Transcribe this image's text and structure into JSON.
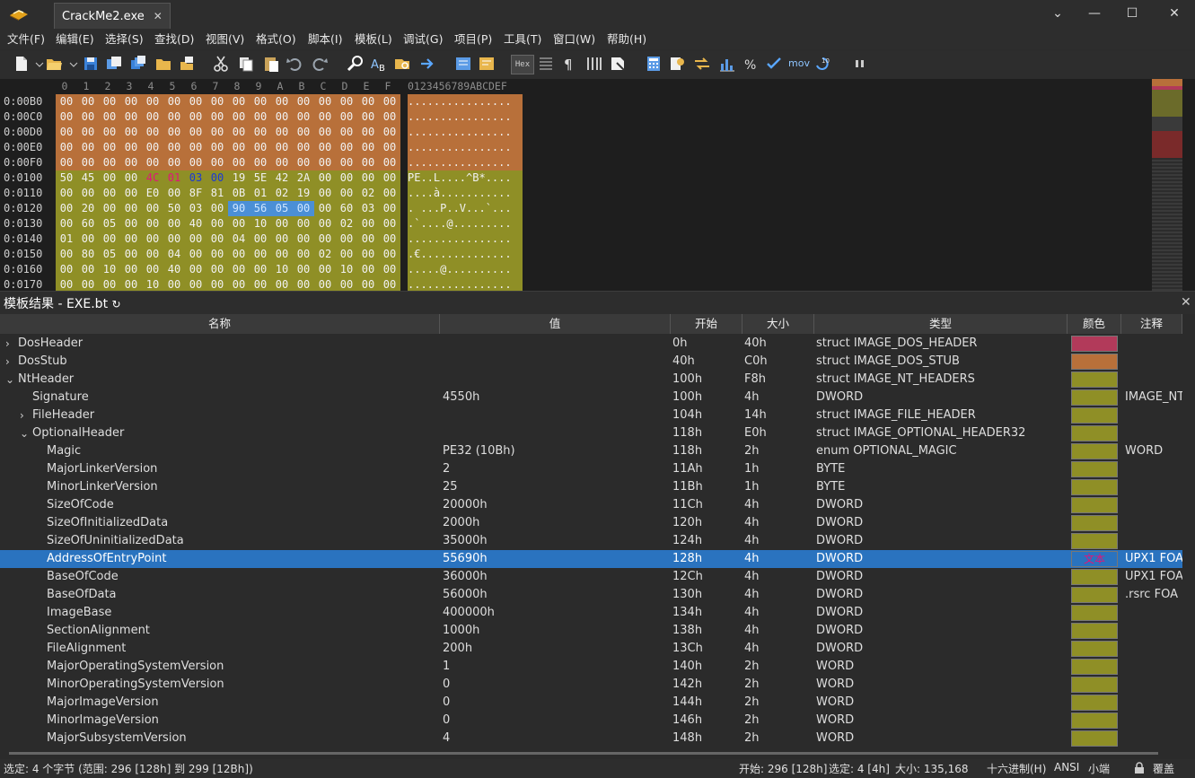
{
  "window": {
    "tab_title": "CrackMe2.exe",
    "tab_close": "✕",
    "controls": [
      "⌄",
      "—",
      "☐",
      "✕"
    ]
  },
  "menu": [
    "文件(F)",
    "编辑(E)",
    "选择(S)",
    "查找(D)",
    "视图(V)",
    "格式(O)",
    "脚本(I)",
    "模板(L)",
    "调试(G)",
    "项目(P)",
    "工具(T)",
    "窗口(W)",
    "帮助(H)"
  ],
  "toolbar": {
    "hex_label": "Hex",
    "mov_label": "mov",
    "icons": [
      "new-file-icon",
      "dropdown-icon",
      "open-folder-icon",
      "dropdown-icon",
      "save-icon",
      "save-as-icon",
      "save-all-icon",
      "open-workspace-icon",
      "folder-tree-icon",
      "cut-icon",
      "copy-icon",
      "paste-icon",
      "undo-icon",
      "redo-icon",
      "find-icon",
      "replace-icon",
      "find-in-files-icon",
      "goto-icon",
      "compare-icon",
      "template-icon",
      "hex-view-icon",
      "column-mode-icon",
      "pilcrow-icon",
      "columns-icon",
      "highlight-icon",
      "calculator-icon",
      "checksum-icon",
      "swap-icon",
      "histogram-icon",
      "percent-icon",
      "check-icon",
      "mov-icon",
      "binary-icon",
      "pause-icon"
    ]
  },
  "hex": {
    "columns": [
      "0",
      "1",
      "2",
      "3",
      "4",
      "5",
      "6",
      "7",
      "8",
      "9",
      "A",
      "B",
      "C",
      "D",
      "E",
      "F"
    ],
    "ascii_header": "0123456789ABCDEF",
    "rows": [
      {
        "addr": "0:00B0",
        "bytes": [
          "00",
          "00",
          "00",
          "00",
          "00",
          "00",
          "00",
          "00",
          "00",
          "00",
          "00",
          "00",
          "00",
          "00",
          "00",
          "00"
        ],
        "ascii": "................"
      },
      {
        "addr": "0:00C0",
        "bytes": [
          "00",
          "00",
          "00",
          "00",
          "00",
          "00",
          "00",
          "00",
          "00",
          "00",
          "00",
          "00",
          "00",
          "00",
          "00",
          "00"
        ],
        "ascii": "................"
      },
      {
        "addr": "0:00D0",
        "bytes": [
          "00",
          "00",
          "00",
          "00",
          "00",
          "00",
          "00",
          "00",
          "00",
          "00",
          "00",
          "00",
          "00",
          "00",
          "00",
          "00"
        ],
        "ascii": "................"
      },
      {
        "addr": "0:00E0",
        "bytes": [
          "00",
          "00",
          "00",
          "00",
          "00",
          "00",
          "00",
          "00",
          "00",
          "00",
          "00",
          "00",
          "00",
          "00",
          "00",
          "00"
        ],
        "ascii": "................"
      },
      {
        "addr": "0:00F0",
        "bytes": [
          "00",
          "00",
          "00",
          "00",
          "00",
          "00",
          "00",
          "00",
          "00",
          "00",
          "00",
          "00",
          "00",
          "00",
          "00",
          "00"
        ],
        "ascii": "................"
      },
      {
        "addr": "0:0100",
        "bytes": [
          "50",
          "45",
          "00",
          "00",
          "4C",
          "01",
          "03",
          "00",
          "19",
          "5E",
          "42",
          "2A",
          "00",
          "00",
          "00",
          "00"
        ],
        "ascii": "PE..L....^B*...."
      },
      {
        "addr": "0:0110",
        "bytes": [
          "00",
          "00",
          "00",
          "00",
          "E0",
          "00",
          "8F",
          "81",
          "0B",
          "01",
          "02",
          "19",
          "00",
          "00",
          "02",
          "00"
        ],
        "ascii": "....à..........."
      },
      {
        "addr": "0:0120",
        "bytes": [
          "00",
          "20",
          "00",
          "00",
          "00",
          "50",
          "03",
          "00",
          "90",
          "56",
          "05",
          "00",
          "00",
          "60",
          "03",
          "00"
        ],
        "ascii": ". ...P..V...`..."
      },
      {
        "addr": "0:0130",
        "bytes": [
          "00",
          "60",
          "05",
          "00",
          "00",
          "00",
          "40",
          "00",
          "00",
          "10",
          "00",
          "00",
          "00",
          "02",
          "00",
          "00"
        ],
        "ascii": ".`....@........."
      },
      {
        "addr": "0:0140",
        "bytes": [
          "01",
          "00",
          "00",
          "00",
          "00",
          "00",
          "00",
          "00",
          "04",
          "00",
          "00",
          "00",
          "00",
          "00",
          "00",
          "00"
        ],
        "ascii": "................"
      },
      {
        "addr": "0:0150",
        "bytes": [
          "00",
          "80",
          "05",
          "00",
          "00",
          "04",
          "00",
          "00",
          "00",
          "00",
          "00",
          "00",
          "02",
          "00",
          "00",
          "00"
        ],
        "ascii": ".€.............."
      },
      {
        "addr": "0:0160",
        "bytes": [
          "00",
          "00",
          "10",
          "00",
          "00",
          "40",
          "00",
          "00",
          "00",
          "00",
          "10",
          "00",
          "00",
          "10",
          "00",
          "00"
        ],
        "ascii": ".....@.........."
      },
      {
        "addr": "0:0170",
        "bytes": [
          "00",
          "00",
          "00",
          "00",
          "10",
          "00",
          "00",
          "00",
          "00",
          "00",
          "00",
          "00",
          "00",
          "00",
          "00",
          "00"
        ],
        "ascii": "................"
      }
    ]
  },
  "colors": {
    "dos_header": "#b23a5a",
    "dos_stub": "#b8703a",
    "nt_header": "#8f8f26",
    "selection": "#2a73bf",
    "swatch_text": "#e0157a"
  },
  "template": {
    "title": "模板结果 - EXE.bt",
    "refresh_icon": "↻",
    "close_icon": "✕",
    "columns": [
      "名称",
      "值",
      "开始",
      "大小",
      "类型",
      "颜色",
      "注释"
    ],
    "rows": [
      {
        "name": "DosHeader",
        "value": "",
        "start": "0h",
        "size": "40h",
        "type": "struct IMAGE_DOS_HEADER",
        "color": "dos_header",
        "swatch_text": "",
        "comment": "",
        "indent": 0,
        "expander": "›"
      },
      {
        "name": "DosStub",
        "value": "",
        "start": "40h",
        "size": "C0h",
        "type": "struct IMAGE_DOS_STUB",
        "color": "dos_stub",
        "swatch_text": "",
        "comment": "",
        "indent": 0,
        "expander": "›"
      },
      {
        "name": "NtHeader",
        "value": "",
        "start": "100h",
        "size": "F8h",
        "type": "struct IMAGE_NT_HEADERS",
        "color": "nt_header",
        "swatch_text": "",
        "comment": "",
        "indent": 0,
        "expander": "⌄"
      },
      {
        "name": "Signature",
        "value": "4550h",
        "start": "100h",
        "size": "4h",
        "type": "DWORD",
        "color": "nt_header",
        "swatch_text": "",
        "comment": "IMAGE_NT",
        "indent": 1,
        "expander": ""
      },
      {
        "name": "FileHeader",
        "value": "",
        "start": "104h",
        "size": "14h",
        "type": "struct IMAGE_FILE_HEADER",
        "color": "nt_header",
        "swatch_text": "",
        "comment": "",
        "indent": 1,
        "expander": "›"
      },
      {
        "name": "OptionalHeader",
        "value": "",
        "start": "118h",
        "size": "E0h",
        "type": "struct IMAGE_OPTIONAL_HEADER32",
        "color": "nt_header",
        "swatch_text": "",
        "comment": "",
        "indent": 1,
        "expander": "⌄"
      },
      {
        "name": "Magic",
        "value": "PE32 (10Bh)",
        "start": "118h",
        "size": "2h",
        "type": "enum OPTIONAL_MAGIC",
        "color": "nt_header",
        "swatch_text": "",
        "comment": "WORD",
        "indent": 2,
        "expander": ""
      },
      {
        "name": "MajorLinkerVersion",
        "value": "2",
        "start": "11Ah",
        "size": "1h",
        "type": "BYTE",
        "color": "nt_header",
        "swatch_text": "",
        "comment": "",
        "indent": 2,
        "expander": ""
      },
      {
        "name": "MinorLinkerVersion",
        "value": "25",
        "start": "11Bh",
        "size": "1h",
        "type": "BYTE",
        "color": "nt_header",
        "swatch_text": "",
        "comment": "",
        "indent": 2,
        "expander": ""
      },
      {
        "name": "SizeOfCode",
        "value": "20000h",
        "start": "11Ch",
        "size": "4h",
        "type": "DWORD",
        "color": "nt_header",
        "swatch_text": "",
        "comment": "",
        "indent": 2,
        "expander": ""
      },
      {
        "name": "SizeOfInitializedData",
        "value": "2000h",
        "start": "120h",
        "size": "4h",
        "type": "DWORD",
        "color": "nt_header",
        "swatch_text": "",
        "comment": "",
        "indent": 2,
        "expander": ""
      },
      {
        "name": "SizeOfUninitializedData",
        "value": "35000h",
        "start": "124h",
        "size": "4h",
        "type": "DWORD",
        "color": "nt_header",
        "swatch_text": "",
        "comment": "",
        "indent": 2,
        "expander": ""
      },
      {
        "name": "AddressOfEntryPoint",
        "value": "55690h",
        "start": "128h",
        "size": "4h",
        "type": "DWORD",
        "color": "selection",
        "swatch_text": "文本",
        "comment": "UPX1 FOA",
        "indent": 2,
        "expander": "",
        "selected": true
      },
      {
        "name": "BaseOfCode",
        "value": "36000h",
        "start": "12Ch",
        "size": "4h",
        "type": "DWORD",
        "color": "nt_header",
        "swatch_text": "",
        "comment": "UPX1 FOA",
        "indent": 2,
        "expander": ""
      },
      {
        "name": "BaseOfData",
        "value": "56000h",
        "start": "130h",
        "size": "4h",
        "type": "DWORD",
        "color": "nt_header",
        "swatch_text": "",
        "comment": ".rsrc FOA",
        "indent": 2,
        "expander": ""
      },
      {
        "name": "ImageBase",
        "value": "400000h",
        "start": "134h",
        "size": "4h",
        "type": "DWORD",
        "color": "nt_header",
        "swatch_text": "",
        "comment": "",
        "indent": 2,
        "expander": ""
      },
      {
        "name": "SectionAlignment",
        "value": "1000h",
        "start": "138h",
        "size": "4h",
        "type": "DWORD",
        "color": "nt_header",
        "swatch_text": "",
        "comment": "",
        "indent": 2,
        "expander": ""
      },
      {
        "name": "FileAlignment",
        "value": "200h",
        "start": "13Ch",
        "size": "4h",
        "type": "DWORD",
        "color": "nt_header",
        "swatch_text": "",
        "comment": "",
        "indent": 2,
        "expander": ""
      },
      {
        "name": "MajorOperatingSystemVersion",
        "value": "1",
        "start": "140h",
        "size": "2h",
        "type": "WORD",
        "color": "nt_header",
        "swatch_text": "",
        "comment": "",
        "indent": 2,
        "expander": ""
      },
      {
        "name": "MinorOperatingSystemVersion",
        "value": "0",
        "start": "142h",
        "size": "2h",
        "type": "WORD",
        "color": "nt_header",
        "swatch_text": "",
        "comment": "",
        "indent": 2,
        "expander": ""
      },
      {
        "name": "MajorImageVersion",
        "value": "0",
        "start": "144h",
        "size": "2h",
        "type": "WORD",
        "color": "nt_header",
        "swatch_text": "",
        "comment": "",
        "indent": 2,
        "expander": ""
      },
      {
        "name": "MinorImageVersion",
        "value": "0",
        "start": "146h",
        "size": "2h",
        "type": "WORD",
        "color": "nt_header",
        "swatch_text": "",
        "comment": "",
        "indent": 2,
        "expander": ""
      },
      {
        "name": "MajorSubsystemVersion",
        "value": "4",
        "start": "148h",
        "size": "2h",
        "type": "WORD",
        "color": "nt_header",
        "swatch_text": "",
        "comment": "",
        "indent": 2,
        "expander": ""
      }
    ]
  },
  "status": {
    "selection": "选定: 4 个字节 (范围: 296 [128h] 到 299 [12Bh])",
    "start": "开始: 296 [128h]",
    "selected": "选定: 4 [4h]",
    "size": "大小: 135,168",
    "mode": "十六进制(H)",
    "encoding": "ANSI",
    "endian": "小端",
    "mode2": "覆盖",
    "lock_icon": "lock-icon"
  }
}
